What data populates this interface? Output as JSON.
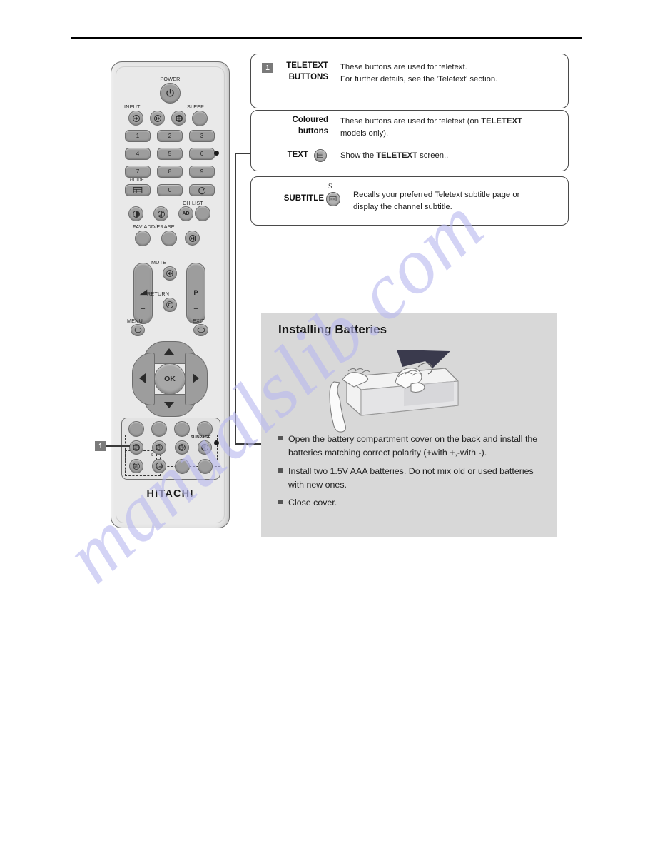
{
  "page": {
    "watermark": "manualslib.com",
    "brand": "HITACHI"
  },
  "callout": {
    "marker_left": "1",
    "marker_box": "1"
  },
  "boxes": [
    {
      "id": "teletext-buttons",
      "marker": "1",
      "label_line1": "TELETEXT",
      "label_line2": "BUTTONS",
      "desc_line1": "These buttons are used for teletext.",
      "desc_line2": "For further details, see the 'Teletext' section."
    },
    {
      "id": "coloured-buttons-text",
      "label_line1": "Coloured",
      "label_line2": "buttons",
      "desc_line1_a": "These buttons are used for teletext (on ",
      "desc_line1_b": "TELETEXT",
      "desc_line2": "models only).",
      "label2": "TEXT",
      "desc2_a": "Show the ",
      "desc2_b": "TELETEXT",
      "desc2_c": " screen.."
    },
    {
      "id": "subtitle",
      "label": "SUBTITLE",
      "desc_line1": "Recalls your preferred Teletext subtitle page or",
      "desc_line2": "display the channel subtitle."
    }
  ],
  "batteries": {
    "title": "Installing Batteries",
    "bullets": [
      "Open the battery compartment cover on the back and install the batteries matching correct polarity (+with +,-with -).",
      "Install two 1.5V AAA batteries. Do not mix old or used batteries with new ones.",
      "Close cover."
    ]
  },
  "remote": {
    "labels": {
      "power": "POWER",
      "input": "INPUT",
      "sleep": "SLEEP",
      "guide": "GUIDE",
      "ch_list": "CH LIST",
      "fav_add_erase": "FAV ADD/ERASE",
      "mute": "MUTE",
      "return": "RETURN",
      "menu": "MENU",
      "exit": "EXIT",
      "subpage": "SUBPAGE",
      "p": "P",
      "ok": "OK",
      "ad": "AD"
    },
    "numbers": [
      "1",
      "2",
      "3",
      "4",
      "5",
      "6",
      "7",
      "8",
      "9",
      "0"
    ],
    "rocker_plus": "+",
    "rocker_minus": "−",
    "icons": {
      "power": "power-icon",
      "input": "input-source-icon",
      "info": "info-icon",
      "aspect": "aspect-ratio-icon",
      "sleep": "sleep-blank-icon",
      "guide": "guide-grid-icon",
      "swap": "channel-swap-icon",
      "picture": "picture-mode-icon",
      "sound": "sound-mode-icon",
      "ad": "audio-description-icon",
      "ch_list": "channel-list-icon",
      "fav": "favourite-icon",
      "add_erase": "add-erase-icon",
      "freeze": "freeze-play-icon",
      "mute": "mute-icon",
      "return": "return-arrow-icon",
      "menu": "menu-icon",
      "exit": "exit-icon",
      "text": "teletext-icon",
      "subtitle": "subtitle-icon",
      "subpage": "subpage-icon"
    }
  }
}
